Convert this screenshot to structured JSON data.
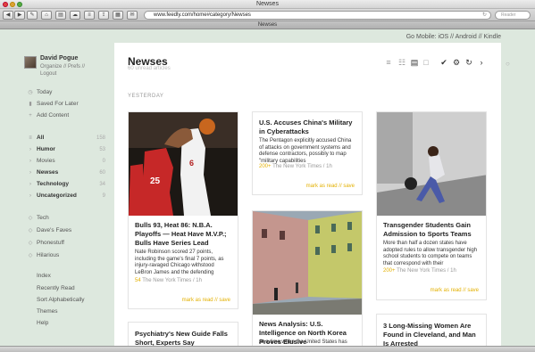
{
  "window": {
    "title": "Newses",
    "tab_title": "Newses"
  },
  "toolbar": {
    "url": "www.feedly.com/home#category/Newses",
    "search_placeholder": "Reader"
  },
  "top_links": {
    "go_mobile": "Go Mobile:",
    "ios": "iOS",
    "android": "Android",
    "kindle": "Kindle",
    "sep": "//"
  },
  "user": {
    "name": "David Pogue",
    "links": "Organize // Prefs //",
    "logout": "Logout"
  },
  "nav": {
    "today": "Today",
    "saved": "Saved For Later",
    "add": "Add Content",
    "categories": [
      {
        "label": "All",
        "count": "158"
      },
      {
        "label": "Humor",
        "count": "53"
      },
      {
        "label": "Movies",
        "count": "0"
      },
      {
        "label": "Newses",
        "count": "60"
      },
      {
        "label": "Technology",
        "count": "34"
      },
      {
        "label": "Uncategorized",
        "count": "9"
      }
    ],
    "tags": [
      "Tech",
      "Dave's Faves",
      "Phonestuff",
      "Hilarious"
    ],
    "extras": [
      "Index",
      "Recently Read",
      "Sort Alphabetically",
      "Themes",
      "Help"
    ]
  },
  "main": {
    "title": "Newses",
    "unread": "60 unread articles",
    "section": "YESTERDAY",
    "mark_read": "mark as read",
    "save": "save",
    "sep": "//"
  },
  "articles": [
    {
      "title": "Bulls 93, Heat 86: N.B.A. Playoffs — Heat Have M.V.P.; Bulls Have Series Lead",
      "snippet": "Nate Robinson scored 27 points, including the game's final 7 points, as injury-ravaged Chicago withstood LeBron James and the defending",
      "count": "54",
      "source": "The New York Times / 1h"
    },
    {
      "title": "U.S. Accuses China's Military in Cyberattacks",
      "snippet": "The Pentagon explicitly accused China of attacks on government systems and defense contractors, possibly to map \"military capabilities",
      "count": "200+",
      "source": "The New York Times / 1h"
    },
    {
      "title": "Transgender Students Gain Admission to Sports Teams",
      "snippet": "More than half a dozen states have adopted rules to allow transgender high school students to compete on teams that correspond with their",
      "count": "200+",
      "source": "The New York Times / 1h"
    },
    {
      "title": "Psychiatry's New Guide Falls Short, Experts Say",
      "snippet": "",
      "count": "",
      "source": ""
    },
    {
      "title": "News Analysis: U.S. Intelligence on North Korea Proves Elusive",
      "snippet": "At a time when the United States has",
      "count": "",
      "source": ""
    },
    {
      "title": "3 Long-Missing Women Are Found in Cleveland, and Man Is Arrested",
      "snippet": "",
      "count": "",
      "source": ""
    }
  ],
  "colors": {
    "accent": "#e3b000",
    "sidebar_bg": "#dde8de",
    "card_border": "#e4e4e4"
  }
}
